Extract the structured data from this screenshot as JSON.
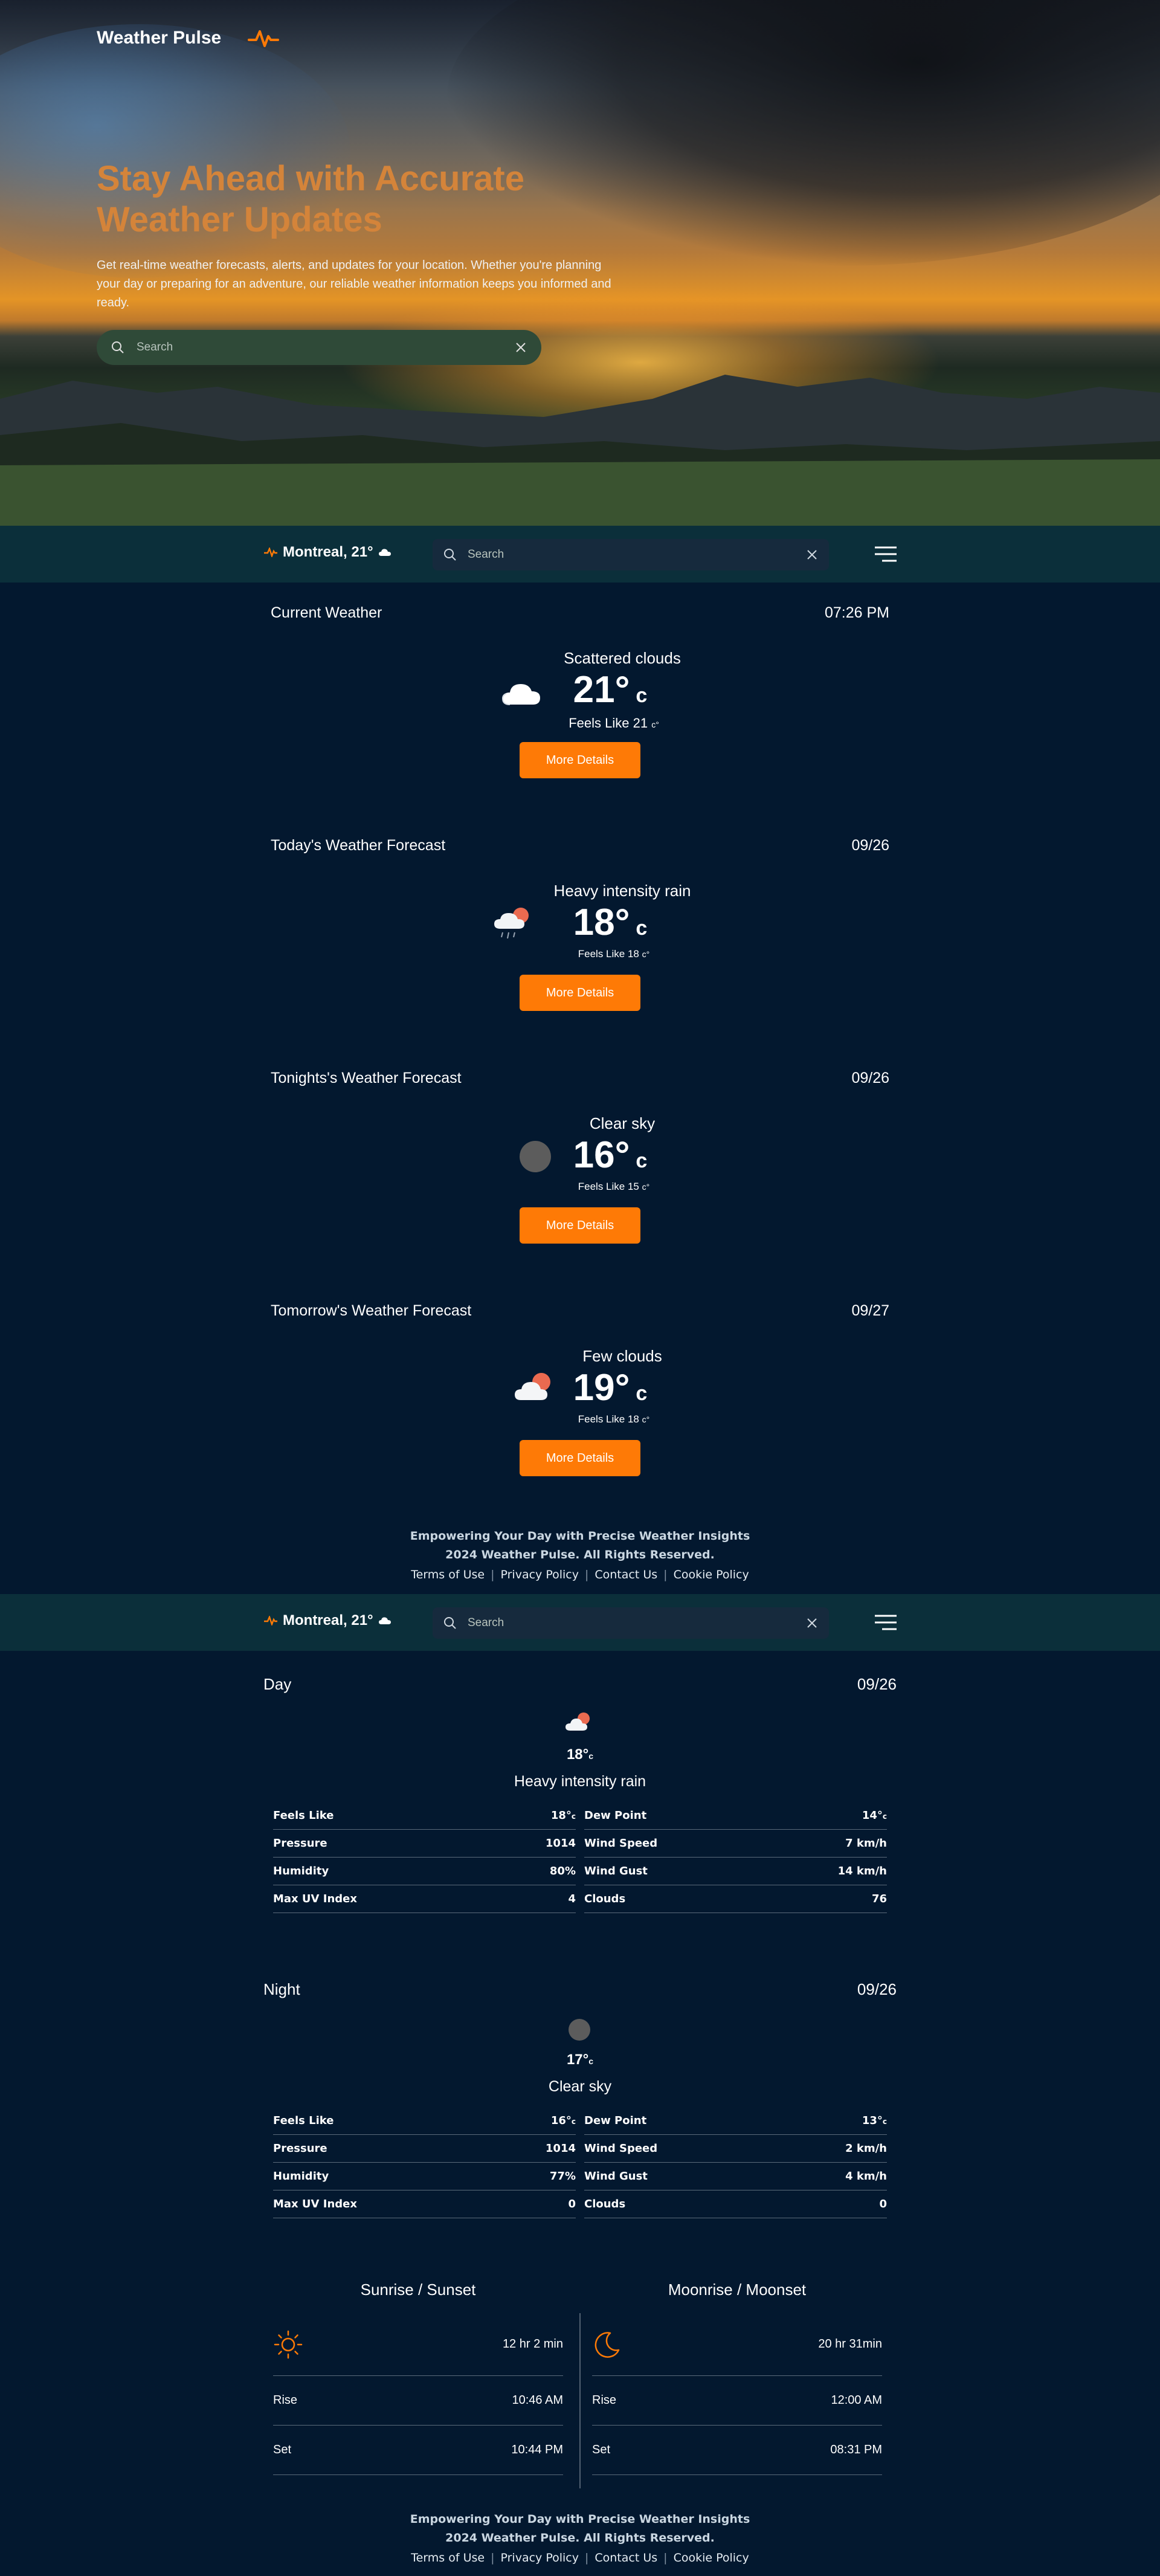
{
  "brand": {
    "name": "Weather Pulse",
    "logo_icon": "pulse-icon",
    "accent": "#fe7a06"
  },
  "hero": {
    "title": "Stay Ahead with Accurate Weather Updates",
    "description": "Get real-time weather forecasts, alerts, and updates for your location. Whether you're planning your day or preparing for an adventure, our reliable weather information keeps you informed and ready.",
    "search_placeholder": "Search"
  },
  "navbar": {
    "location": "Montreal, 21°",
    "search_placeholder": "Search"
  },
  "forecasts": [
    {
      "title": "Current Weather",
      "date": "07:26 PM",
      "description": "Scattered clouds",
      "temp": "21°",
      "unit": "c",
      "feels": "Feels Like 21",
      "feels_unit": "c°",
      "icon": "cloud-icon",
      "button": "More Details"
    },
    {
      "title": "Today's Weather Forecast",
      "date": "09/26",
      "description": "Heavy intensity rain",
      "temp": "18°",
      "unit": "c",
      "feels": "Feels Like 18",
      "feels_unit": "c°",
      "icon": "rain-sun-icon",
      "button": "More Details"
    },
    {
      "title": "Tonights's Weather Forecast",
      "date": "09/26",
      "description": "Clear sky",
      "temp": "16°",
      "unit": "c",
      "feels": "Feels Like 15",
      "feels_unit": "c°",
      "icon": "moon-icon",
      "button": "More Details"
    },
    {
      "title": "Tomorrow's Weather Forecast",
      "date": "09/27",
      "description": "Few clouds",
      "temp": "19°",
      "unit": "c",
      "feels": "Feels Like 18",
      "feels_unit": "c°",
      "icon": "sun-cloud-icon",
      "button": "More Details"
    }
  ],
  "footer": {
    "tagline": "Empowering Your Day with Precise Weather Insights",
    "copyright": "2024 Weather Pulse. All Rights Reserved.",
    "links": [
      "Terms of Use",
      "Privacy Policy",
      "Contact Us",
      "Cookie Policy"
    ]
  },
  "day": {
    "title": "Day",
    "date": "09/26",
    "temp": "18°",
    "temp_unit": "c",
    "description": "Heavy intensity rain",
    "left": [
      {
        "label": "Feels Like",
        "value": "18°",
        "unit": "c"
      },
      {
        "label": "Pressure",
        "value": "1014",
        "unit": ""
      },
      {
        "label": "Humidity",
        "value": "80%",
        "unit": ""
      },
      {
        "label": "Max UV Index",
        "value": "4",
        "unit": ""
      }
    ],
    "right": [
      {
        "label": "Dew Point",
        "value": "14°",
        "unit": "c"
      },
      {
        "label": "Wind Speed",
        "value": "7 km/h",
        "unit": ""
      },
      {
        "label": "Wind Gust",
        "value": "14 km/h",
        "unit": ""
      },
      {
        "label": "Clouds",
        "value": "76",
        "unit": ""
      }
    ]
  },
  "night": {
    "title": "Night",
    "date": "09/26",
    "temp": "17°",
    "temp_unit": "c",
    "description": "Clear sky",
    "left": [
      {
        "label": "Feels Like",
        "value": "16°",
        "unit": "c"
      },
      {
        "label": "Pressure",
        "value": "1014",
        "unit": ""
      },
      {
        "label": "Humidity",
        "value": "77%",
        "unit": ""
      },
      {
        "label": "Max UV Index",
        "value": "0",
        "unit": ""
      }
    ],
    "right": [
      {
        "label": "Dew Point",
        "value": "13°",
        "unit": "c"
      },
      {
        "label": "Wind Speed",
        "value": "2 km/h",
        "unit": ""
      },
      {
        "label": "Wind Gust",
        "value": "4 km/h",
        "unit": ""
      },
      {
        "label": "Clouds",
        "value": "0",
        "unit": ""
      }
    ]
  },
  "sun": {
    "title": "Sunrise / Sunset",
    "duration": "12 hr 2 min",
    "rise_label": "Rise",
    "rise": "10:46 AM",
    "set_label": "Set",
    "set": "10:44 PM"
  },
  "moon": {
    "title": "Moonrise / Moonset",
    "duration": "20 hr 31min",
    "rise_label": "Rise",
    "rise": "12:00 AM",
    "set_label": "Set",
    "set": "08:31 PM"
  }
}
